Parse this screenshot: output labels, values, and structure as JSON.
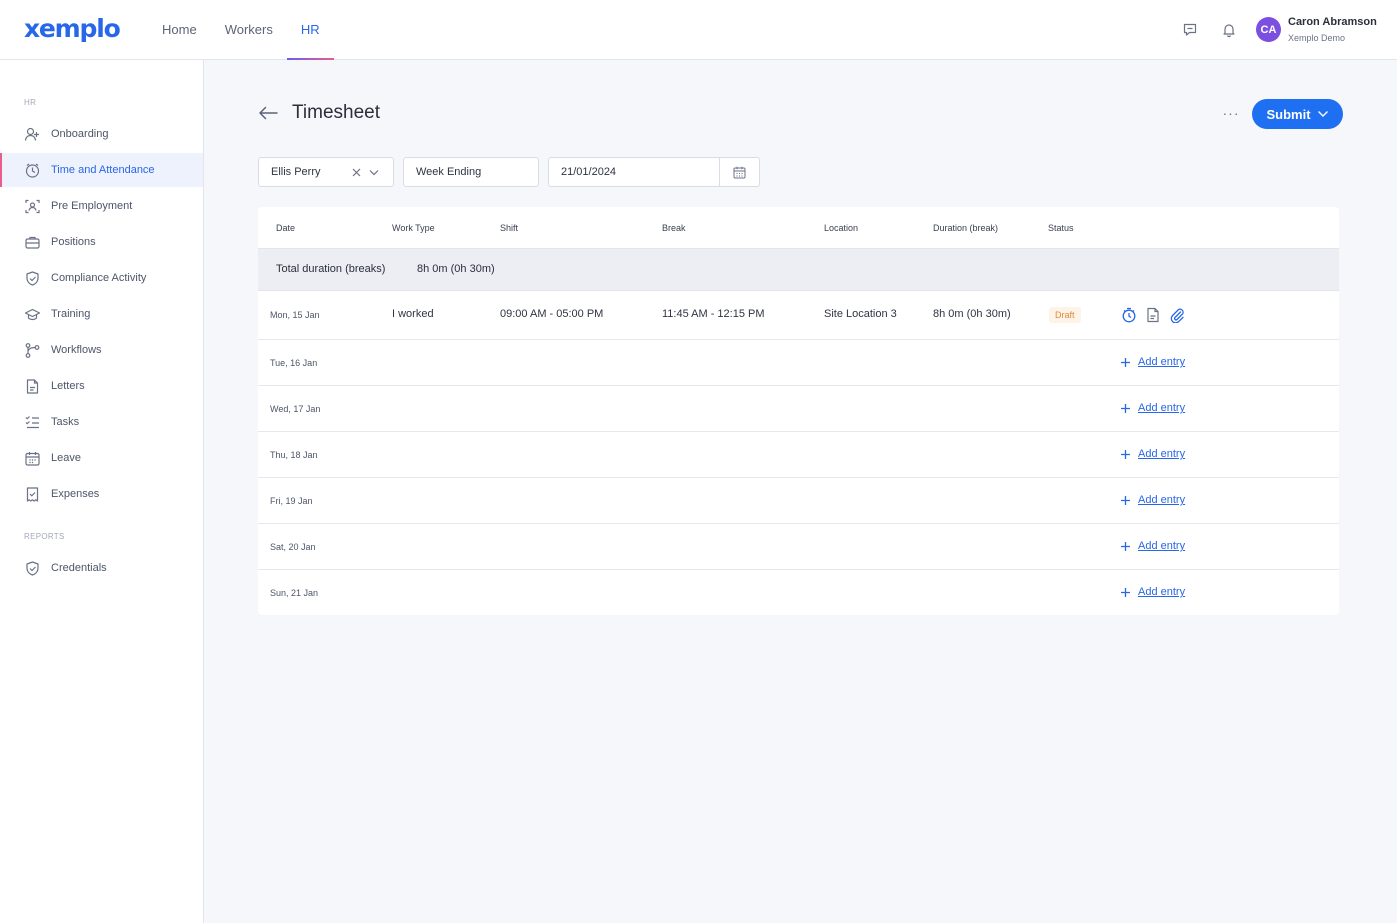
{
  "brand": {
    "logo": "xemplo",
    "accent": "#2767e8",
    "submit_color": "#1f6ff2"
  },
  "topnav": [
    {
      "label": "Home"
    },
    {
      "label": "Workers"
    },
    {
      "label": "HR",
      "active": true
    }
  ],
  "header_icons": [
    "chat-icon",
    "bell-icon"
  ],
  "user": {
    "initials": "CA",
    "name": "Caron Abramson",
    "org": "Xemplo Demo"
  },
  "sidebar": {
    "hr_section": "HR",
    "reports_section": "REPORTS",
    "items": [
      {
        "label": "Onboarding",
        "icon": "user-plus-icon"
      },
      {
        "label": "Time and Attendance",
        "icon": "clock-icon",
        "active": true
      },
      {
        "label": "Pre Employment",
        "icon": "user-scan-icon"
      },
      {
        "label": "Positions",
        "icon": "briefcase-icon"
      },
      {
        "label": "Compliance Activity",
        "icon": "shield-check-icon"
      },
      {
        "label": "Training",
        "icon": "graduation-cap-icon"
      },
      {
        "label": "Workflows",
        "icon": "workflow-icon"
      },
      {
        "label": "Letters",
        "icon": "document-icon"
      },
      {
        "label": "Tasks",
        "icon": "checklist-icon"
      },
      {
        "label": "Leave",
        "icon": "calendar-icon"
      },
      {
        "label": "Expenses",
        "icon": "receipt-icon"
      }
    ],
    "report_items": [
      {
        "label": "Credentials",
        "icon": "shield-check-icon"
      }
    ]
  },
  "page": {
    "title": "Timesheet",
    "submit_label": "Submit",
    "more_label": "···"
  },
  "filters": {
    "worker": "Ellis Perry",
    "period_type": "Week Ending",
    "date": "21/01/2024"
  },
  "table": {
    "columns": [
      "Date",
      "Work Type",
      "Shift",
      "Break",
      "Location",
      "Duration (break)",
      "Status"
    ],
    "total_label": "Total duration (breaks)",
    "total_value": "8h 0m (0h 30m)",
    "entry": {
      "date": "Mon, 15 Jan",
      "work_type": "I worked",
      "shift": "09:00 AM - 05:00 PM",
      "break": "11:45 AM - 12:15 PM",
      "location": "Site Location 3",
      "duration": "8h 0m (0h 30m)",
      "status": "Draft",
      "status_color": "#e2893a"
    },
    "empty_days": [
      "Tue, 16 Jan",
      "Wed, 17 Jan",
      "Thu, 18 Jan",
      "Fri, 19 Jan",
      "Sat, 20 Jan",
      "Sun, 21 Jan"
    ],
    "add_entry_label": "Add entry"
  }
}
